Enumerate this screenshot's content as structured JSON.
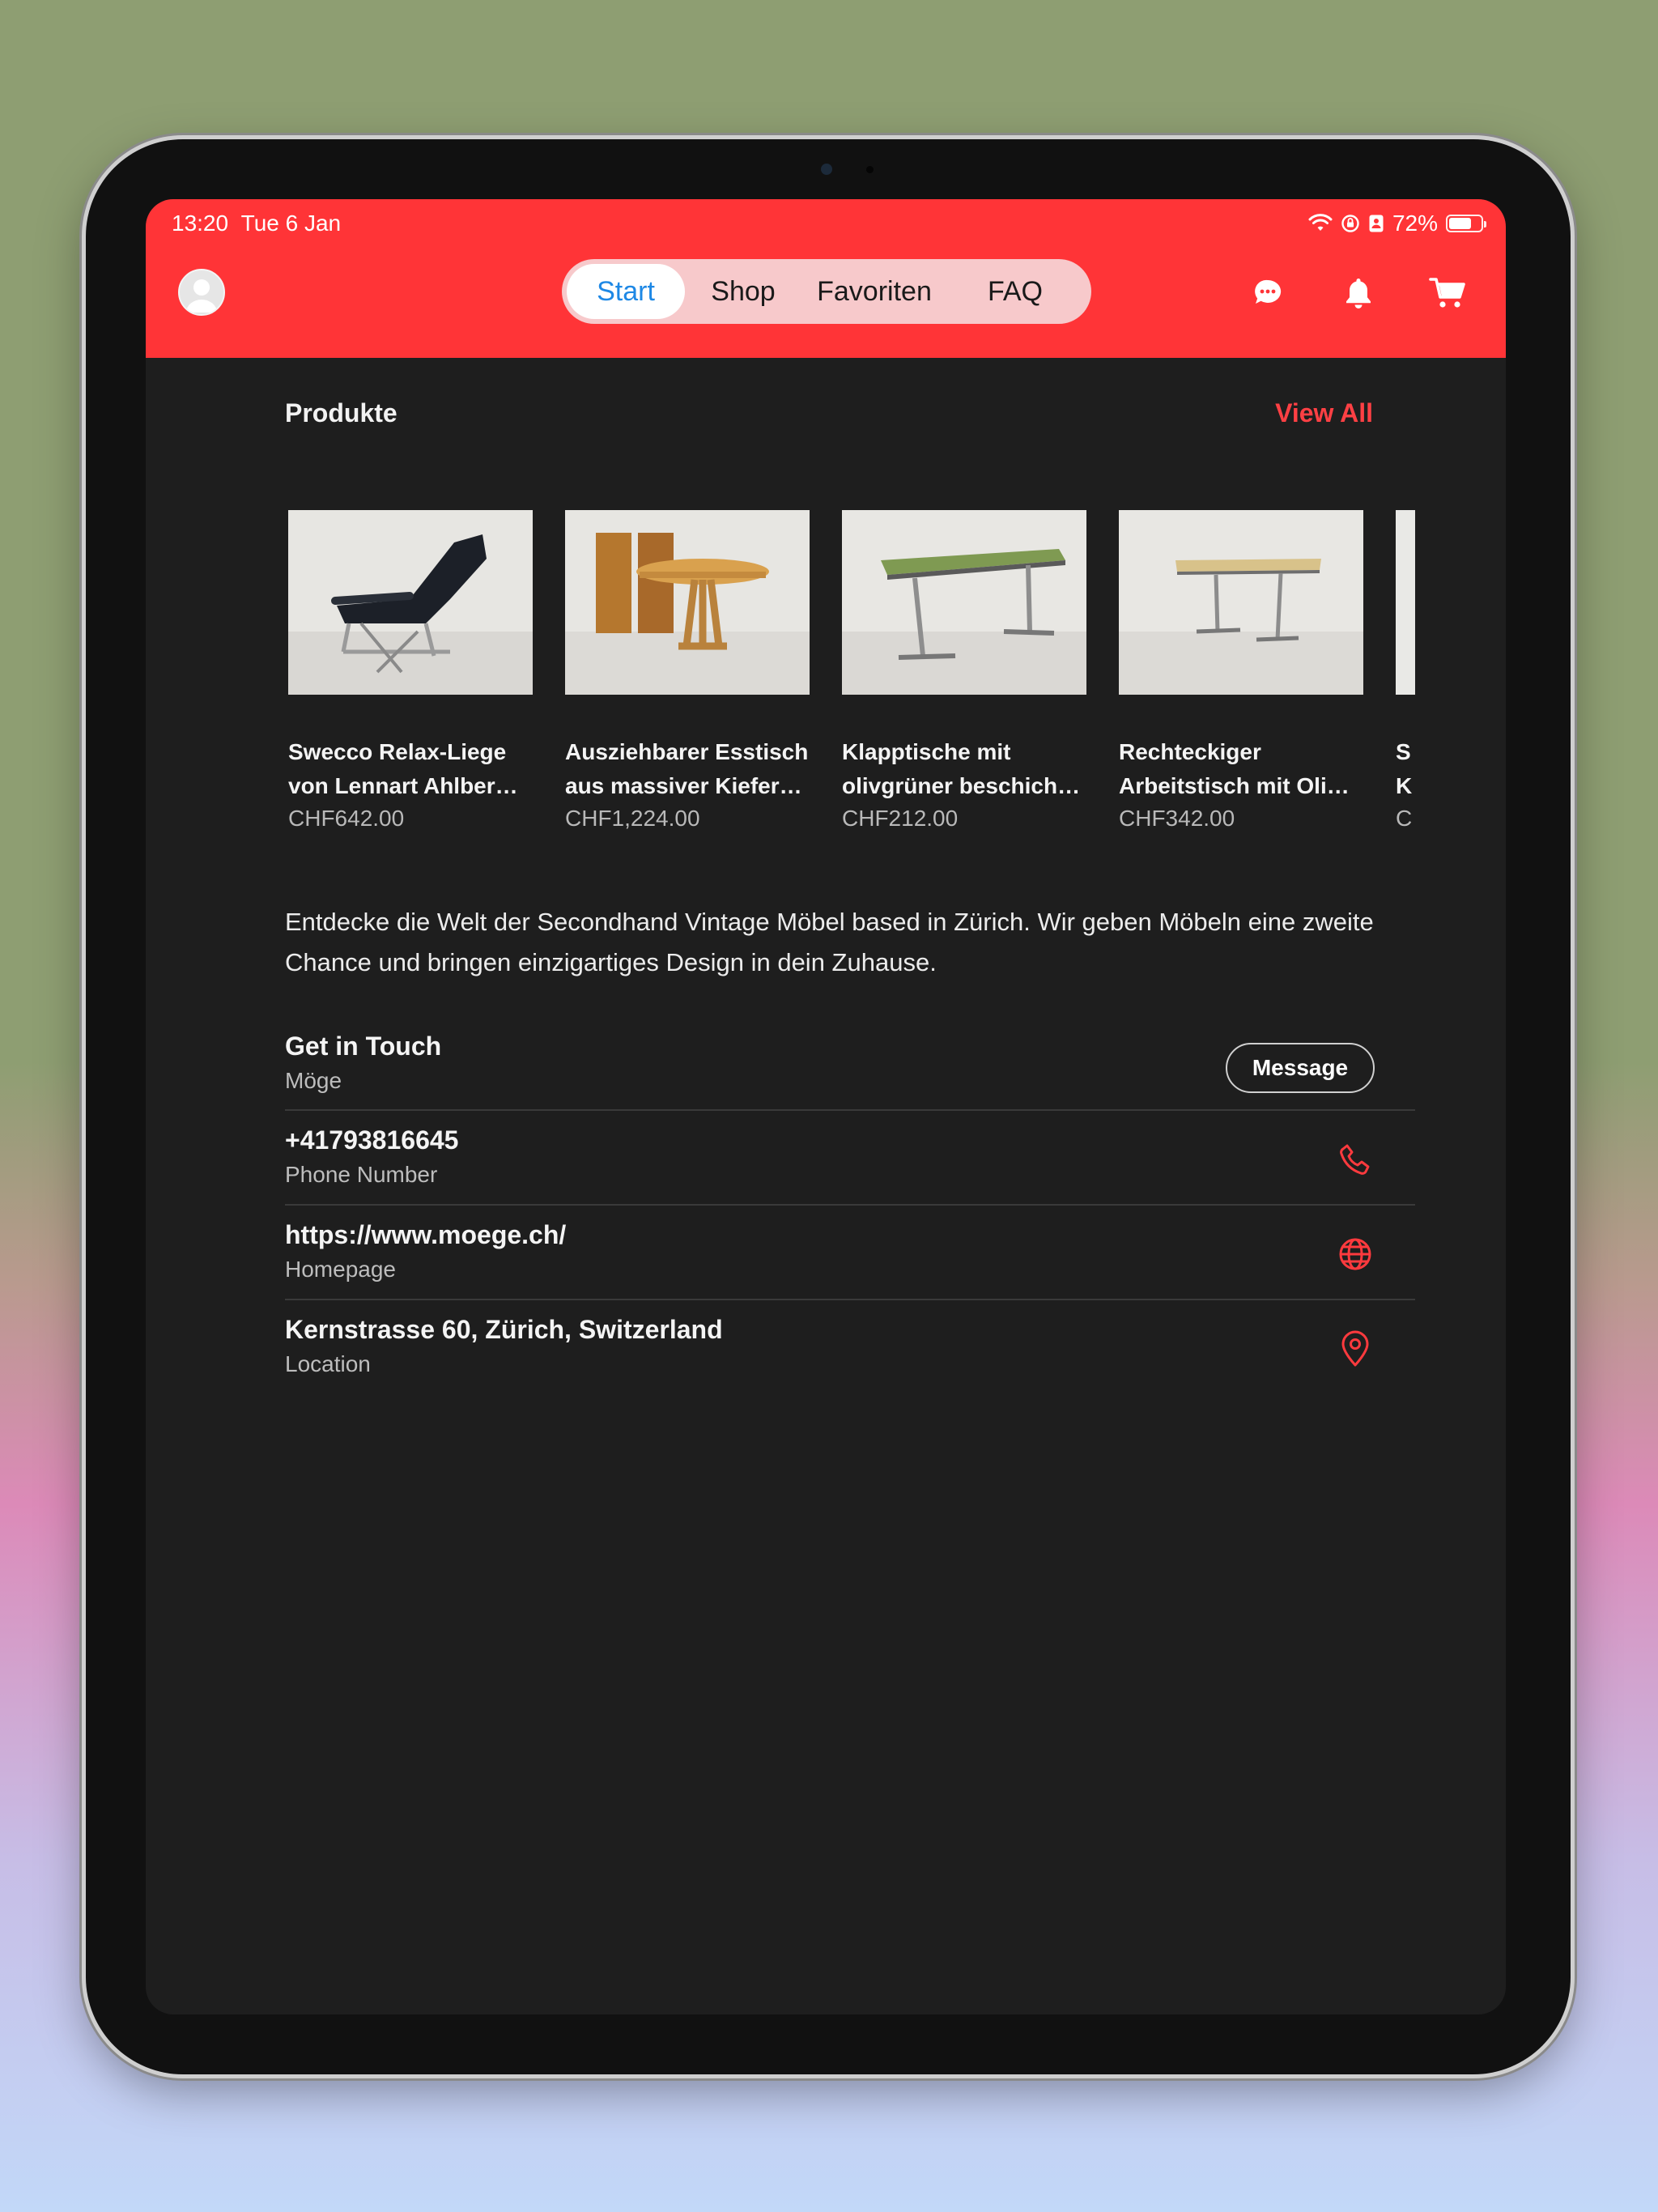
{
  "status": {
    "time": "13:20",
    "date": "Tue 6 Jan",
    "battery": "72%",
    "battery_level": 0.72
  },
  "nav": {
    "tabs": [
      {
        "label": "Start",
        "active": true
      },
      {
        "label": "Shop",
        "active": false
      },
      {
        "label": "Favoriten",
        "active": false
      },
      {
        "label": "FAQ",
        "active": false
      }
    ]
  },
  "colors": {
    "brand": "#ff3437",
    "accent_text": "#ff4044",
    "active_tab_text": "#1e88e5",
    "background": "#1e1e1e"
  },
  "products": {
    "title": "Produkte",
    "view_all": "View All",
    "items": [
      {
        "name_line1": "Swecco Relax-Liege",
        "name_line2": "von Lennart Ahlber…",
        "price": "CHF642.00"
      },
      {
        "name_line1": "Ausziehbarer Esstisch",
        "name_line2": "aus massiver Kiefer…",
        "price": "CHF1,224.00"
      },
      {
        "name_line1": "Klapptische mit",
        "name_line2": "olivgrüner beschich…",
        "price": "CHF212.00"
      },
      {
        "name_line1": "Rechteckiger",
        "name_line2": "Arbeitstisch mit Oli…",
        "price": "CHF342.00"
      },
      {
        "name_line1": "S",
        "name_line2": "K",
        "price": "C"
      }
    ]
  },
  "description": "Entdecke die Welt der Secondhand Vintage Möbel based in Zürich. Wir geben Möbeln eine zweite Chance und bringen einzigartiges Design in dein Zuhause.",
  "contact": {
    "title": "Get in Touch",
    "subtitle": "Möge",
    "message_button": "Message",
    "phone": {
      "value": "+41793816645",
      "label": "Phone Number",
      "icon": "phone-icon"
    },
    "homepage": {
      "value": "https://www.moege.ch/",
      "label": "Homepage",
      "icon": "globe-icon"
    },
    "location": {
      "value": "Kernstrasse 60, Zürich, Switzerland",
      "label": "Location",
      "icon": "location-pin-icon"
    }
  }
}
